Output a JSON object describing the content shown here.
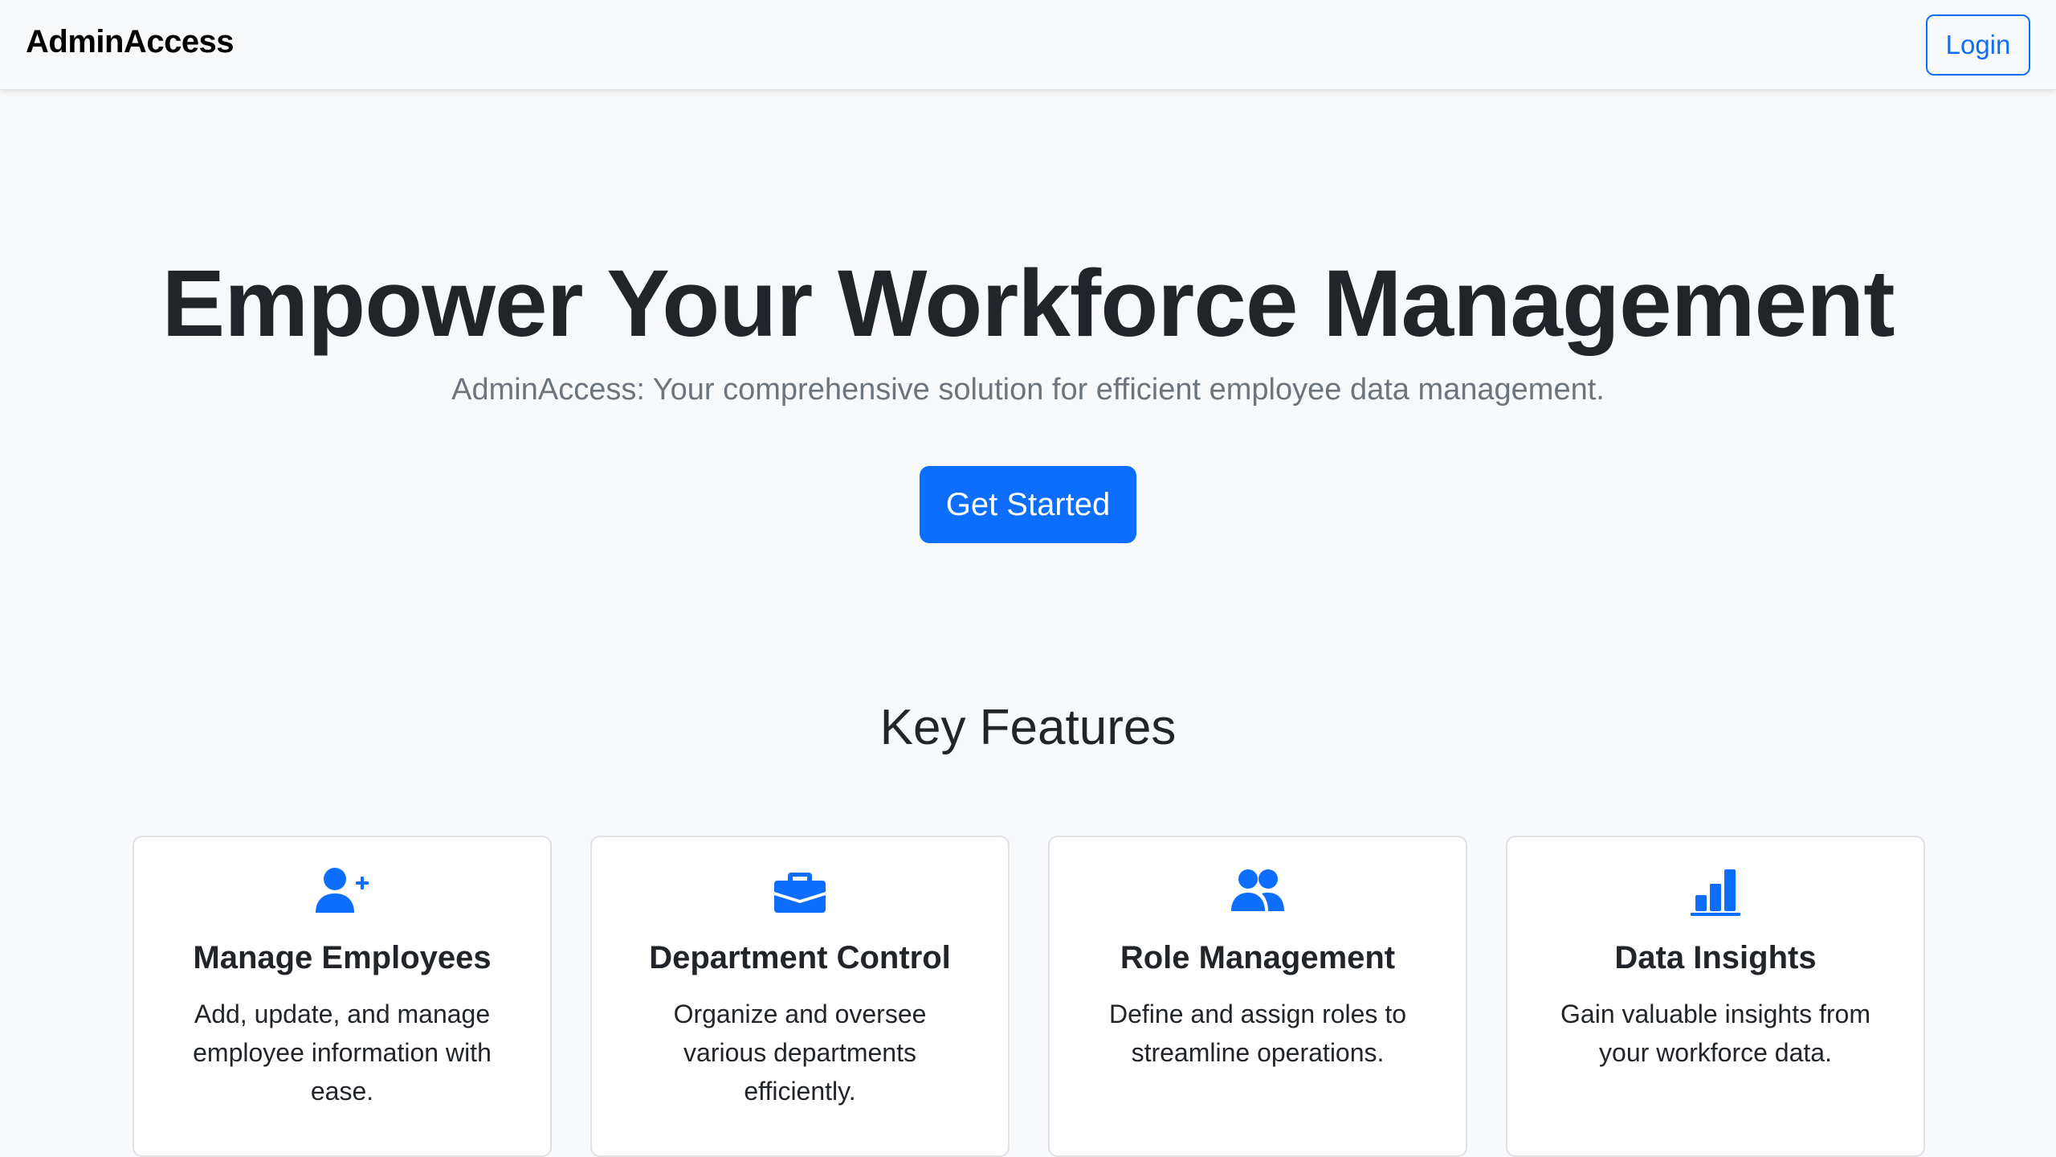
{
  "navbar": {
    "brand": "AdminAccess",
    "login_label": "Login"
  },
  "hero": {
    "title": "Empower Your Workforce Management",
    "subtitle": "AdminAccess: Your comprehensive solution for efficient employee data management.",
    "cta_label": "Get Started"
  },
  "features": {
    "heading": "Key Features",
    "items": [
      {
        "icon": "user-plus-icon",
        "title": "Manage Employees",
        "text": "Add, update, and manage employee information with ease."
      },
      {
        "icon": "briefcase-icon",
        "title": "Department Control",
        "text": "Organize and oversee various departments efficiently."
      },
      {
        "icon": "people-icon",
        "title": "Role Management",
        "text": "Define and assign roles to streamline operations."
      },
      {
        "icon": "bar-chart-icon",
        "title": "Data Insights",
        "text": "Gain valuable insights from your workforce data."
      }
    ]
  },
  "colors": {
    "primary": "#0d6efd",
    "background": "#f8f9fa",
    "text": "#212529",
    "muted": "#6c757d"
  }
}
